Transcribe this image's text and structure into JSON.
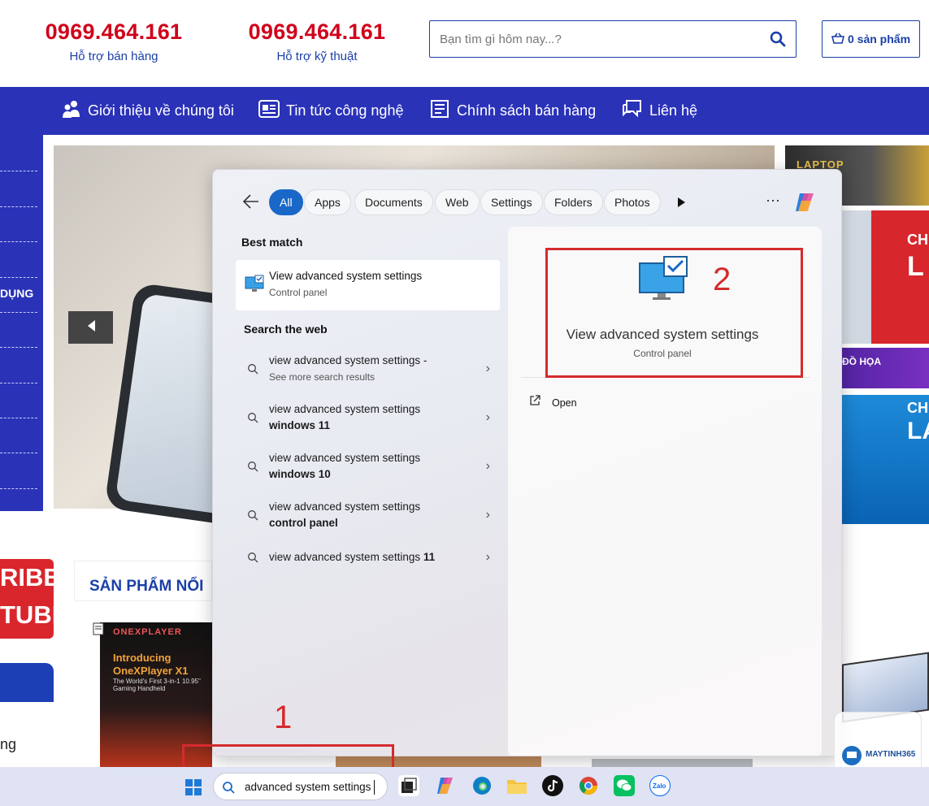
{
  "header": {
    "hotlines": [
      {
        "number": "0969.464.161",
        "label": "Hỗ trợ bán hàng"
      },
      {
        "number": "0969.464.161",
        "label": "Hỗ trợ kỹ thuật"
      }
    ],
    "search_placeholder": "Bạn tìm gì hôm nay...?",
    "cart_label": "0 sản phẩm"
  },
  "nav": {
    "items": [
      {
        "label": "Giới thiệu về chúng tôi",
        "icon": "users-icon"
      },
      {
        "label": "Tin tức công nghệ",
        "icon": "newspaper-icon"
      },
      {
        "label": "Chính sách bán hàng",
        "icon": "policy-icon"
      },
      {
        "label": "Liên hệ",
        "icon": "chat-icon"
      }
    ]
  },
  "sidebar": {
    "visible_label": "DỤNG"
  },
  "page": {
    "section_title": "SẢN PHẨM NỔI",
    "subscribe_badge": [
      "RIBE",
      "TUBE"
    ],
    "side_text": "ng",
    "right_ad_texts": [
      "LAPTOP",
      "CHƯ",
      "L",
      "ĐỒ HỌA",
      "CHƯ",
      "LA"
    ],
    "product_brand": "ONEXPLAYER",
    "product_title_1": "Introducing",
    "product_title_2": "OneXPlayer X1",
    "product_tag": "The World's First 3-in-1 10.95\" Gaming Handheld"
  },
  "search_flyout": {
    "filters": [
      "All",
      "Apps",
      "Documents",
      "Web",
      "Settings",
      "Folders",
      "Photos"
    ],
    "active_filter": "All",
    "best_match_heading": "Best match",
    "best_match": {
      "title": "View advanced system settings",
      "subtitle": "Control panel"
    },
    "web_heading": "Search the web",
    "web_results": [
      {
        "text": "view advanced system settings -",
        "bold": "",
        "sub": "See more search results"
      },
      {
        "text": "view advanced system settings",
        "bold": "windows 11",
        "sub": ""
      },
      {
        "text": "view advanced system settings",
        "bold": "windows 10",
        "sub": ""
      },
      {
        "text": "view advanced system settings",
        "bold": "control panel",
        "sub": ""
      },
      {
        "text": "view advanced system settings ",
        "bold": "11",
        "sub": ""
      }
    ],
    "detail": {
      "title": "View advanced system settings",
      "subtitle": "Control panel",
      "action_open": "Open"
    }
  },
  "annotations": {
    "label_1": "1",
    "label_2": "2",
    "color": "#d42b2e"
  },
  "taskbar": {
    "search_value": "advanced system settings",
    "apps": [
      "task-view-icon",
      "copilot-icon",
      "edge-icon",
      "file-explorer-icon",
      "tiktok-icon",
      "chrome-icon",
      "wechat-icon",
      "zalo-icon"
    ]
  },
  "watermark": {
    "brand": "MAYTINH365"
  },
  "colors": {
    "brand_blue": "#2a32b8",
    "hotline_red": "#d0021b",
    "accent": "#1968c8"
  }
}
